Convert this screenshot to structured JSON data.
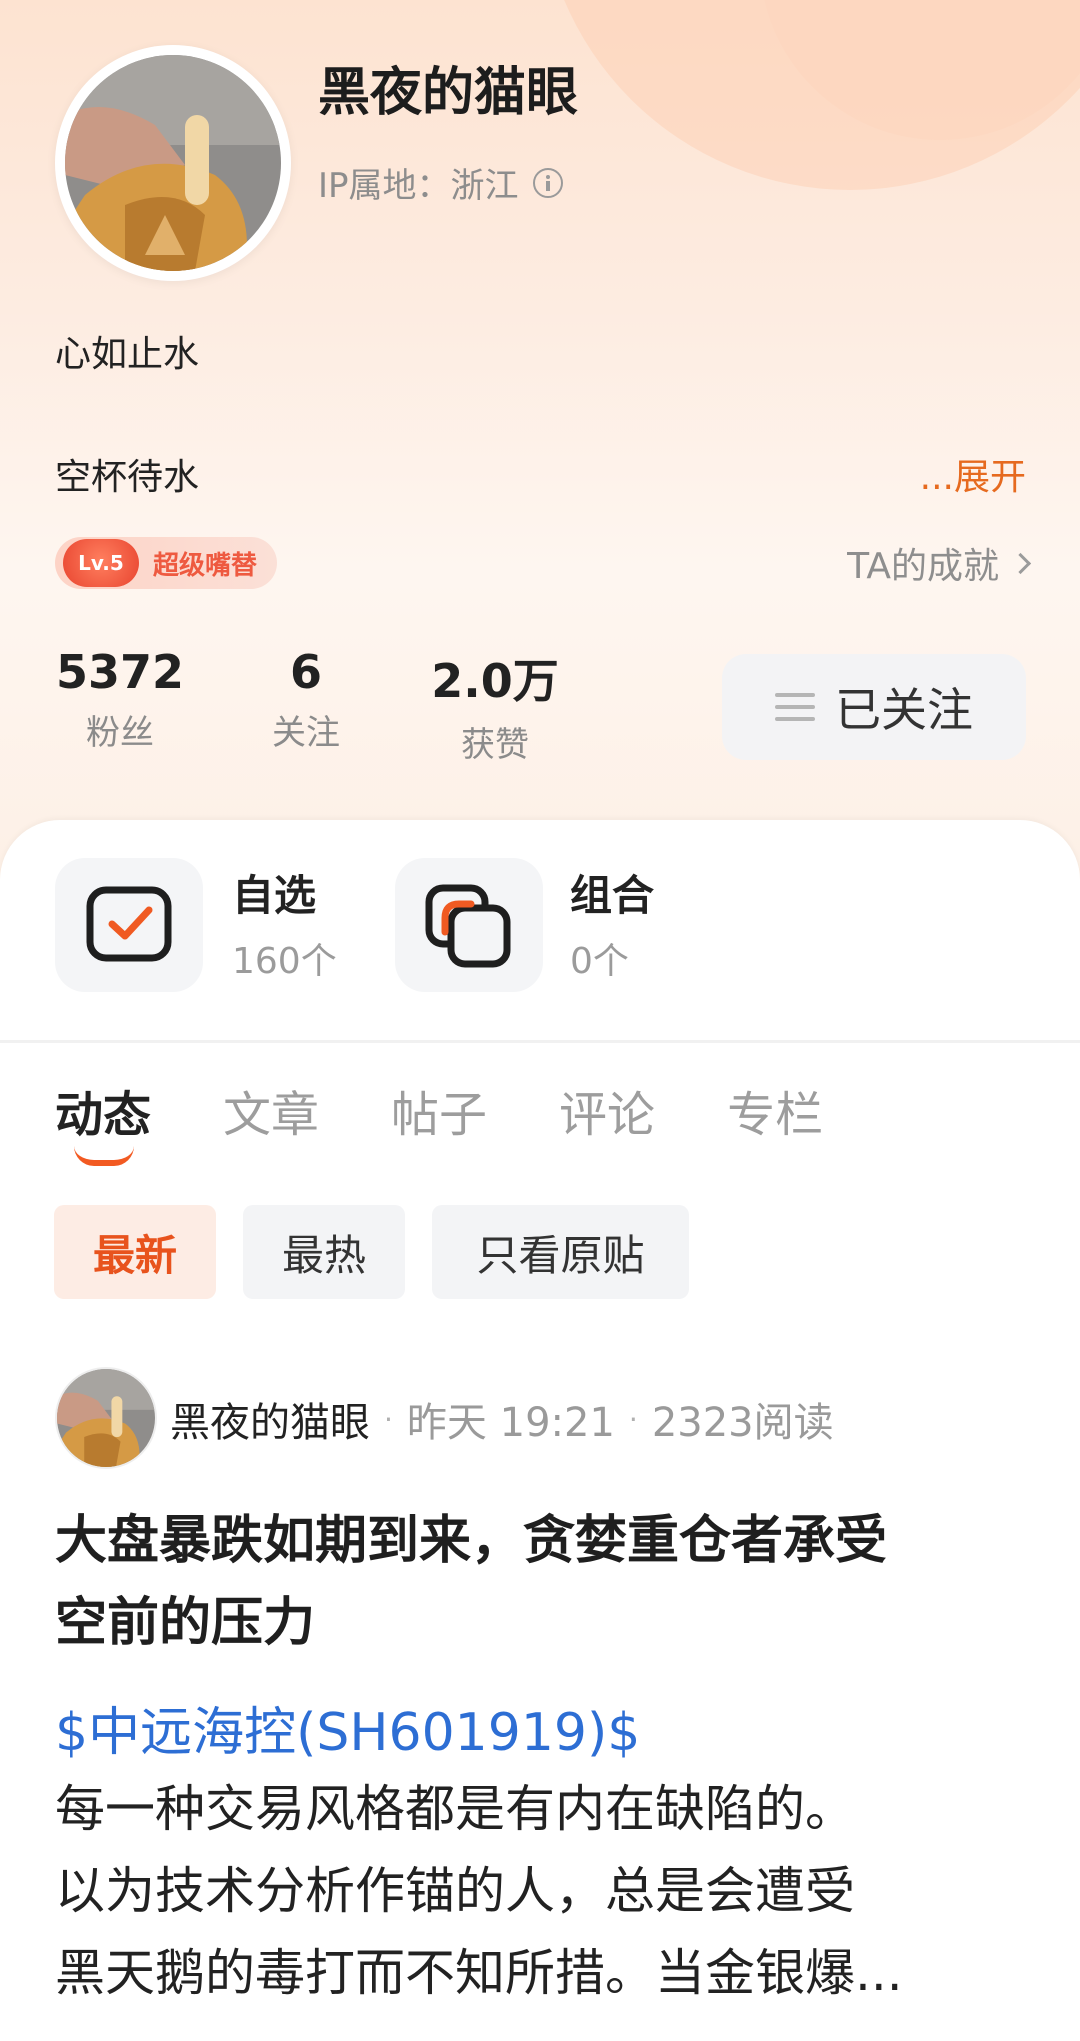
{
  "profile": {
    "username": "黑夜的猫眼",
    "ip_location": "IP属地：浙江",
    "bio_line1": "心如止水",
    "bio_line2": "空杯待水",
    "expand_label": "...展开",
    "badge_level": "Lv.5",
    "badge_title": "超级嘴替",
    "achievements_label": "TA的成就"
  },
  "stats": [
    {
      "value": "5372",
      "label": "粉丝"
    },
    {
      "value": "6",
      "label": "关注"
    },
    {
      "value": "2.0万",
      "label": "获赞"
    }
  ],
  "follow_button": {
    "label": "已关注"
  },
  "tiles": [
    {
      "title": "自选",
      "count": "160个"
    },
    {
      "title": "组合",
      "count": "0个"
    }
  ],
  "tabs": [
    "动态",
    "文章",
    "帖子",
    "评论",
    "专栏"
  ],
  "filters": [
    "最新",
    "最热",
    "只看原贴"
  ],
  "post": {
    "author": "黑夜的猫眼",
    "time": "昨天 19:21",
    "reads": "2323阅读",
    "title_line1": "大盘暴跌如期到来，贪婪重仓者承受",
    "title_line2": "空前的压力",
    "stock_tag": "$中远海控(SH601919)$",
    "body_line1": "每一种交易风格都是有内在缺陷的。",
    "body_line2": "以为技术分析作锚的人，总是会遭受",
    "body_line3": "黑天鹅的毒打而不知所措。当金银爆..."
  },
  "colors": {
    "accent": "#f25a22",
    "link": "#2d6ed4"
  }
}
